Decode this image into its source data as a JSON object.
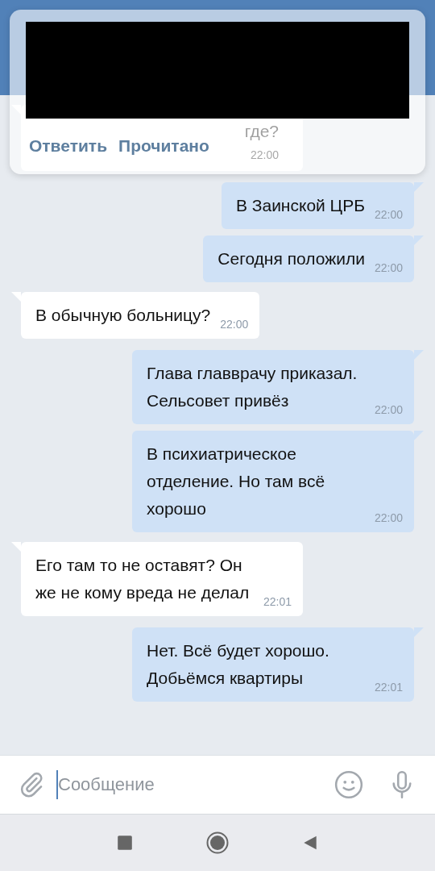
{
  "notification": {
    "preview_redacted": true,
    "actions": [
      "Ответить",
      "Прочитано"
    ]
  },
  "messages": [
    {
      "kind": "incoming",
      "text": "где?",
      "time": "22:00"
    },
    {
      "kind": "outgoing",
      "text": "В Заинской ЦРБ",
      "time": "22:00"
    },
    {
      "kind": "outgoing",
      "text": "Сегодня положили",
      "time": "22:00"
    },
    {
      "kind": "incoming",
      "text": "В обычную больницу?",
      "time": "22:00"
    },
    {
      "kind": "outgoing",
      "text": "Глава главврачу приказал. Сельсовет привёз",
      "time": "22:00"
    },
    {
      "kind": "outgoing",
      "text": "В психиатрическое отделение. Но там всё хорошо",
      "time": "22:00"
    },
    {
      "kind": "incoming",
      "text": "Его там то не оставят? Он же не кому вреда не делал",
      "time": "22:01"
    },
    {
      "kind": "outgoing",
      "text": "Нет. Всё будет хорошо. Добьёмся квартиры",
      "time": "22:01"
    }
  ],
  "composer": {
    "placeholder": "Сообщение"
  }
}
